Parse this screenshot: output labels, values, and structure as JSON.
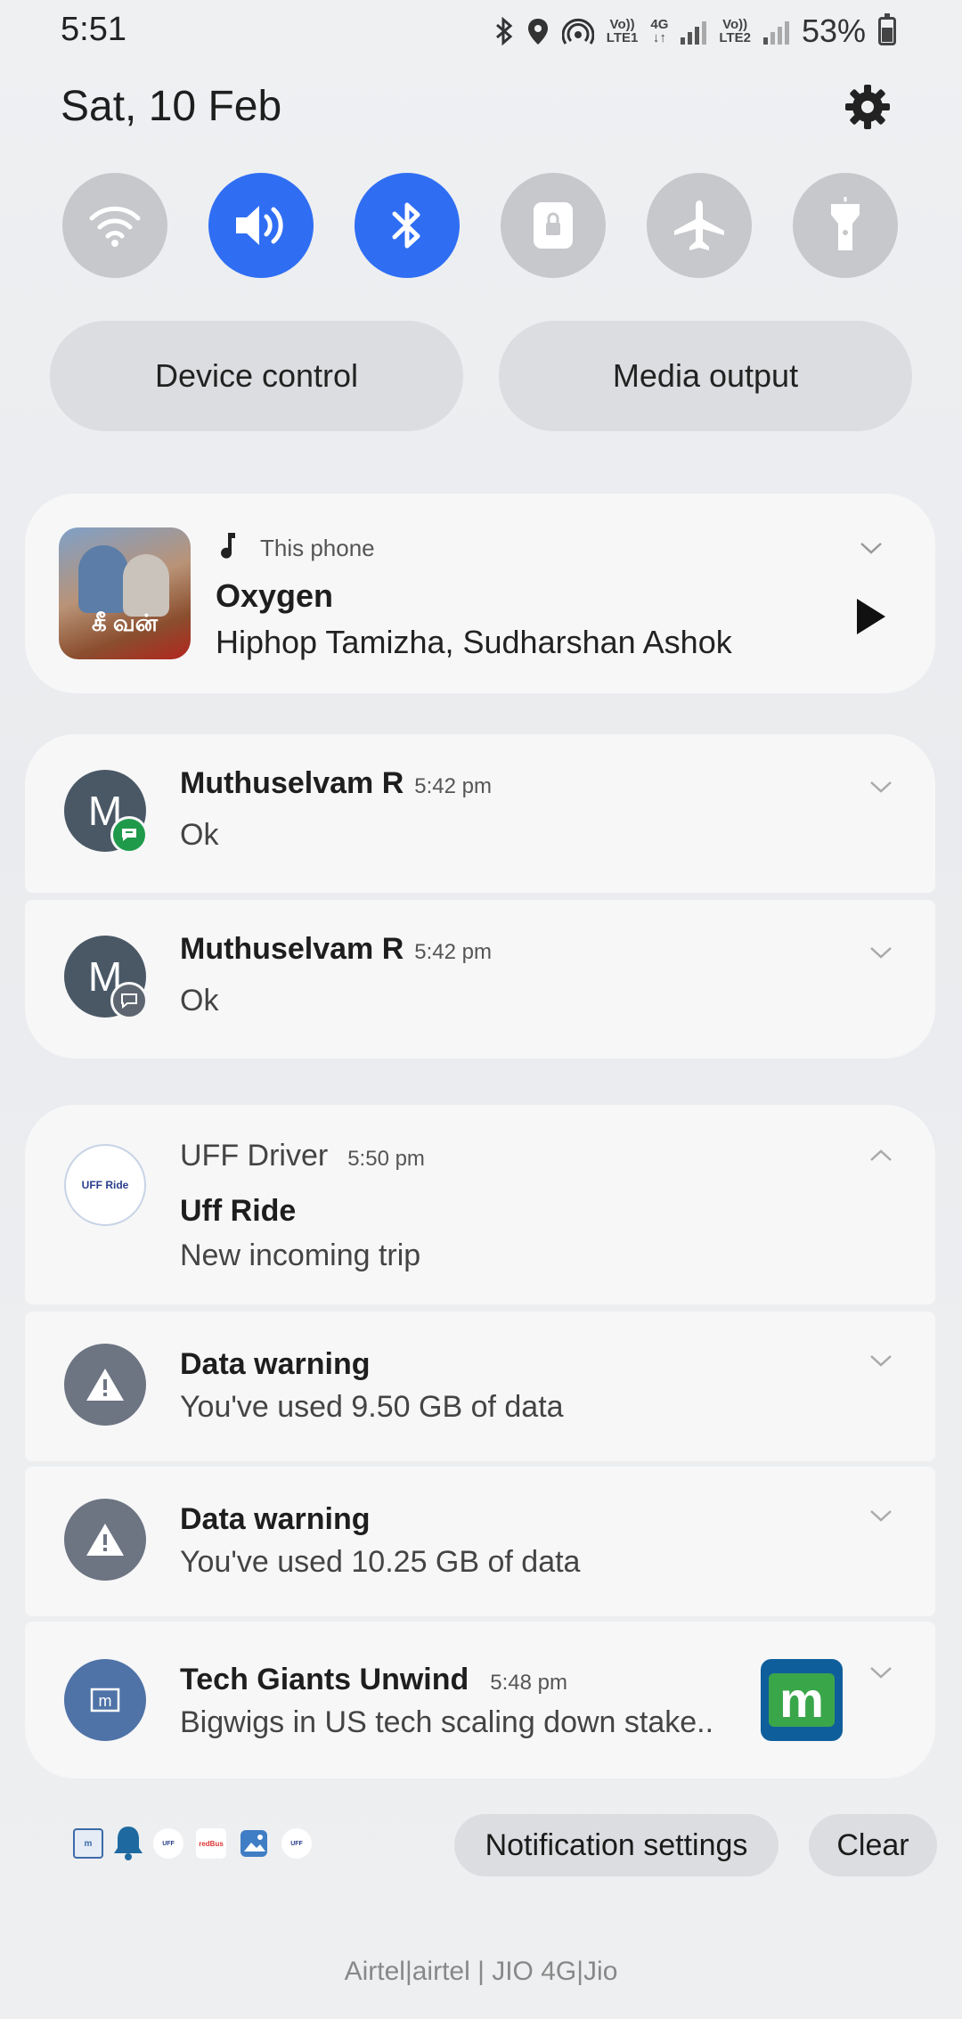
{
  "status_bar": {
    "time": "5:51",
    "volte1_top": "Vo))",
    "volte1_bottom": "LTE1",
    "net_top": "4G",
    "net_bottom": "↓↑",
    "volte2_top": "Vo))",
    "volte2_bottom": "LTE2",
    "battery": "53%"
  },
  "header": {
    "date": "Sat, 10 Feb"
  },
  "quick_toggles": [
    {
      "name": "wifi",
      "on": false
    },
    {
      "name": "sound",
      "on": true
    },
    {
      "name": "bluetooth",
      "on": true
    },
    {
      "name": "rotation-lock",
      "on": false
    },
    {
      "name": "airplane-mode",
      "on": false
    },
    {
      "name": "flashlight",
      "on": false
    }
  ],
  "buttons": {
    "device_control": "Device control",
    "media_output": "Media output"
  },
  "media": {
    "source": "This phone",
    "title": "Oxygen",
    "artist": "Hiphop Tamizha, Sudharshan Ashok",
    "album_text": "கீ வன்"
  },
  "notifications": {
    "msg1": {
      "initial": "M",
      "name": "Muthuselvam R",
      "time": "5:42 pm",
      "text": "Ok"
    },
    "msg2": {
      "initial": "M",
      "name": "Muthuselvam R",
      "time": "5:42 pm",
      "text": "Ok"
    },
    "uff": {
      "app": "UFF Driver",
      "time": "5:50 pm",
      "title": "Uff Ride",
      "text": "New incoming trip",
      "logo_text": "UFF Ride"
    },
    "data1": {
      "title": "Data warning",
      "text": "You've used 9.50 GB of data"
    },
    "data2": {
      "title": "Data warning",
      "text": "You've used 10.25 GB of data"
    },
    "tech": {
      "title": "Tech Giants Unwind",
      "time": "5:48 pm",
      "text": "Bigwigs in US tech scaling down stake..",
      "icon_letter": "m"
    }
  },
  "footer": {
    "notification_settings": "Notification settings",
    "clear": "Clear",
    "mini_icons": [
      "m",
      "UFF",
      "redBus",
      "UFF"
    ],
    "carrier": "Airtel|airtel | JIO 4G|Jio"
  },
  "colors": {
    "accent": "#2f6ef3",
    "toggle_off": "#c6c8cb",
    "card": "#f7f7f8"
  }
}
